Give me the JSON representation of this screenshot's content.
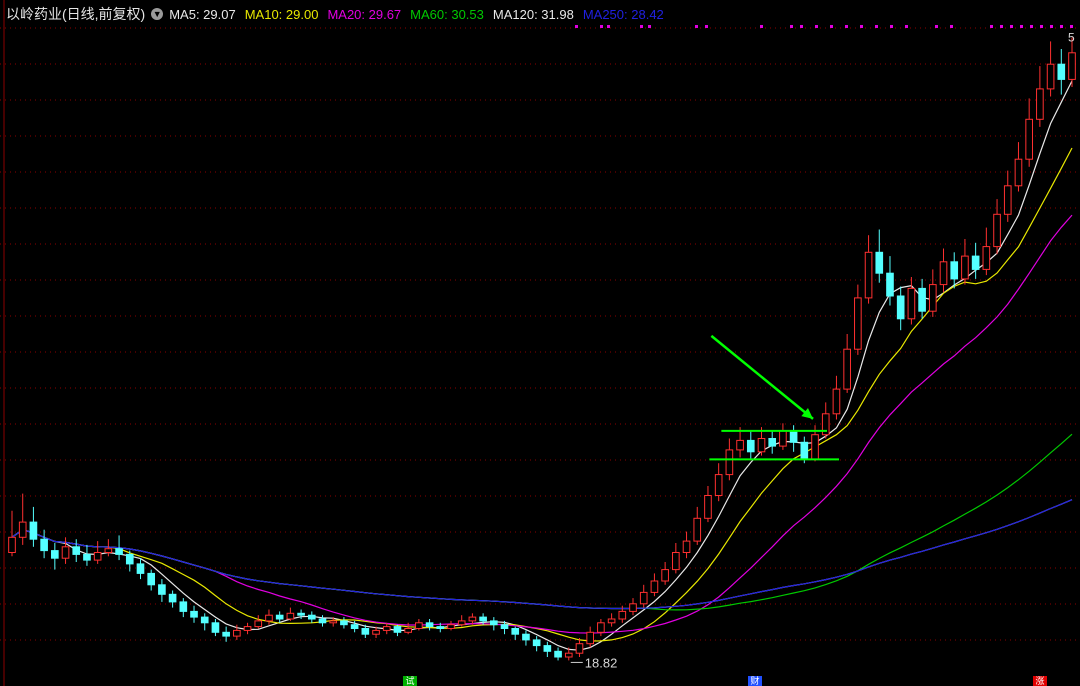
{
  "header": {
    "stock_title": "以岭药业(日线,前复权)",
    "toggle_icon": "chevron-down-icon",
    "ma_legend": [
      {
        "label": "MA5: 29.07",
        "color": "#e8e8e8"
      },
      {
        "label": "MA10: 29.00",
        "color": "#e8e800"
      },
      {
        "label": "MA20: 29.67",
        "color": "#e000e0"
      },
      {
        "label": "MA60: 30.53",
        "color": "#00c800"
      },
      {
        "label": "MA120: 31.98",
        "color": "#e8e8e8"
      },
      {
        "label": "MA250: 28.42",
        "color": "#2020e0"
      }
    ]
  },
  "annotations": {
    "low_label": "18.82",
    "high_label": "5"
  },
  "bottom_markers": [
    {
      "label": "试",
      "color": "#00b000"
    },
    {
      "label": "财",
      "color": "#2050ff"
    },
    {
      "label": "涨",
      "color": "#e00000"
    }
  ],
  "colors": {
    "background": "#000000",
    "grid": "#8b0000",
    "up_candle": "#ff3030",
    "down_candle": "#54ffff",
    "ma5": "#e8e8e8",
    "ma10": "#e8e800",
    "ma20": "#e000e0",
    "ma60": "#00c800",
    "ma120": "#d8d8d8",
    "ma250": "#2020e0",
    "annotation": "#00ff00",
    "dots": "#e000e0"
  },
  "chart_data": {
    "type": "candlestick",
    "price_range": [
      18.0,
      52.0
    ],
    "grid": true,
    "candles": [
      [
        24.5,
        25.3,
        26.7,
        24.3
      ],
      [
        25.3,
        26.1,
        27.6,
        24.9
      ],
      [
        26.1,
        25.2,
        26.9,
        24.8
      ],
      [
        25.2,
        24.6,
        25.7,
        24.2
      ],
      [
        24.6,
        24.2,
        25.0,
        23.6
      ],
      [
        24.2,
        24.8,
        25.3,
        23.9
      ],
      [
        24.8,
        24.4,
        25.2,
        24.0
      ],
      [
        24.4,
        24.1,
        24.9,
        23.8
      ],
      [
        24.1,
        24.5,
        25.1,
        23.9
      ],
      [
        24.5,
        24.7,
        25.2,
        24.3
      ],
      [
        24.7,
        24.4,
        25.4,
        24.1
      ],
      [
        24.4,
        23.9,
        24.6,
        23.5
      ],
      [
        23.9,
        23.4,
        24.2,
        23.1
      ],
      [
        23.4,
        22.8,
        23.6,
        22.5
      ],
      [
        22.8,
        22.3,
        23.1,
        21.9
      ],
      [
        22.3,
        21.9,
        22.5,
        21.6
      ],
      [
        21.9,
        21.4,
        22.1,
        21.1
      ],
      [
        21.4,
        21.1,
        21.7,
        20.8
      ],
      [
        21.1,
        20.8,
        21.3,
        20.4
      ],
      [
        20.8,
        20.3,
        21.0,
        20.1
      ],
      [
        20.3,
        20.1,
        20.6,
        19.8
      ],
      [
        20.1,
        20.4,
        20.7,
        19.9
      ],
      [
        20.4,
        20.6,
        20.8,
        20.2
      ],
      [
        20.6,
        20.9,
        21.2,
        20.5
      ],
      [
        20.9,
        21.2,
        21.5,
        20.7
      ],
      [
        21.2,
        21.0,
        21.4,
        20.8
      ],
      [
        21.0,
        21.3,
        21.6,
        20.9
      ],
      [
        21.3,
        21.2,
        21.5,
        21.0
      ],
      [
        21.2,
        21.0,
        21.4,
        20.8
      ],
      [
        21.0,
        20.8,
        21.2,
        20.6
      ],
      [
        20.8,
        20.9,
        21.1,
        20.6
      ],
      [
        20.9,
        20.7,
        21.1,
        20.5
      ],
      [
        20.7,
        20.5,
        20.9,
        20.3
      ],
      [
        20.5,
        20.2,
        20.7,
        20.0
      ],
      [
        20.2,
        20.4,
        20.6,
        20.0
      ],
      [
        20.4,
        20.6,
        20.8,
        20.2
      ],
      [
        20.6,
        20.3,
        20.7,
        20.1
      ],
      [
        20.3,
        20.5,
        20.8,
        20.2
      ],
      [
        20.5,
        20.8,
        21.0,
        20.4
      ],
      [
        20.8,
        20.6,
        21.0,
        20.4
      ],
      [
        20.6,
        20.5,
        20.8,
        20.3
      ],
      [
        20.5,
        20.7,
        20.9,
        20.4
      ],
      [
        20.7,
        20.9,
        21.2,
        20.6
      ],
      [
        20.9,
        21.1,
        21.3,
        20.7
      ],
      [
        21.1,
        20.9,
        21.3,
        20.7
      ],
      [
        20.9,
        20.7,
        21.1,
        20.4
      ],
      [
        20.7,
        20.5,
        20.9,
        20.2
      ],
      [
        20.5,
        20.2,
        20.6,
        19.9
      ],
      [
        20.2,
        19.9,
        20.4,
        19.6
      ],
      [
        19.9,
        19.6,
        20.1,
        19.3
      ],
      [
        19.6,
        19.3,
        19.8,
        19.0
      ],
      [
        19.3,
        19.0,
        19.5,
        18.82
      ],
      [
        19.0,
        19.2,
        19.5,
        18.82
      ],
      [
        19.2,
        19.7,
        20.0,
        19.0
      ],
      [
        19.7,
        20.3,
        20.6,
        19.5
      ],
      [
        20.3,
        20.8,
        21.0,
        20.1
      ],
      [
        20.8,
        21.0,
        21.3,
        20.6
      ],
      [
        21.0,
        21.4,
        21.7,
        20.8
      ],
      [
        21.4,
        21.8,
        22.1,
        21.2
      ],
      [
        21.8,
        22.4,
        22.8,
        21.6
      ],
      [
        22.4,
        23.0,
        23.4,
        22.2
      ],
      [
        23.0,
        23.6,
        24.0,
        22.8
      ],
      [
        23.6,
        24.5,
        25.0,
        23.4
      ],
      [
        24.5,
        25.1,
        25.6,
        24.2
      ],
      [
        25.1,
        26.3,
        26.9,
        24.9
      ],
      [
        26.3,
        27.5,
        28.0,
        26.1
      ],
      [
        27.5,
        28.6,
        29.2,
        27.2
      ],
      [
        28.6,
        29.9,
        30.5,
        28.3
      ],
      [
        29.9,
        30.4,
        31.1,
        29.5
      ],
      [
        30.4,
        29.8,
        30.9,
        29.4
      ],
      [
        29.8,
        30.5,
        31.1,
        29.6
      ],
      [
        30.5,
        30.1,
        30.9,
        29.7
      ],
      [
        30.1,
        30.9,
        31.3,
        29.9
      ],
      [
        30.9,
        30.3,
        31.2,
        29.8
      ],
      [
        30.3,
        29.4,
        30.6,
        29.2
      ],
      [
        29.4,
        30.7,
        31.2,
        29.3
      ],
      [
        30.7,
        31.8,
        32.4,
        30.5
      ],
      [
        31.8,
        33.1,
        33.8,
        31.5
      ],
      [
        33.1,
        35.2,
        36.0,
        32.9
      ],
      [
        35.2,
        37.9,
        38.6,
        34.9
      ],
      [
        37.9,
        40.3,
        41.2,
        37.6
      ],
      [
        40.3,
        39.2,
        41.5,
        38.7
      ],
      [
        39.2,
        38.0,
        40.1,
        37.5
      ],
      [
        38.0,
        36.8,
        38.5,
        36.2
      ],
      [
        36.8,
        38.4,
        39.0,
        36.5
      ],
      [
        38.4,
        37.2,
        38.9,
        36.8
      ],
      [
        37.2,
        38.6,
        39.4,
        36.9
      ],
      [
        38.6,
        39.8,
        40.5,
        38.2
      ],
      [
        39.8,
        38.9,
        40.3,
        38.4
      ],
      [
        38.9,
        40.1,
        41.0,
        38.6
      ],
      [
        40.1,
        39.4,
        40.8,
        38.9
      ],
      [
        39.4,
        40.6,
        41.6,
        39.1
      ],
      [
        40.6,
        42.3,
        43.1,
        40.2
      ],
      [
        42.3,
        43.8,
        44.6,
        41.9
      ],
      [
        43.8,
        45.2,
        46.1,
        43.5
      ],
      [
        45.2,
        47.3,
        48.4,
        44.8
      ],
      [
        47.3,
        48.9,
        50.1,
        46.9
      ],
      [
        48.9,
        50.2,
        51.4,
        48.5
      ],
      [
        50.2,
        49.4,
        51.0,
        48.6
      ],
      [
        49.4,
        50.8,
        51.6,
        49.0
      ]
    ],
    "ma_periods": [
      5,
      10,
      20,
      60,
      120,
      250
    ],
    "consolidation_box": {
      "top_price": 30.9,
      "bottom_price": 29.4,
      "start_index": 67,
      "end_index": 75
    }
  }
}
